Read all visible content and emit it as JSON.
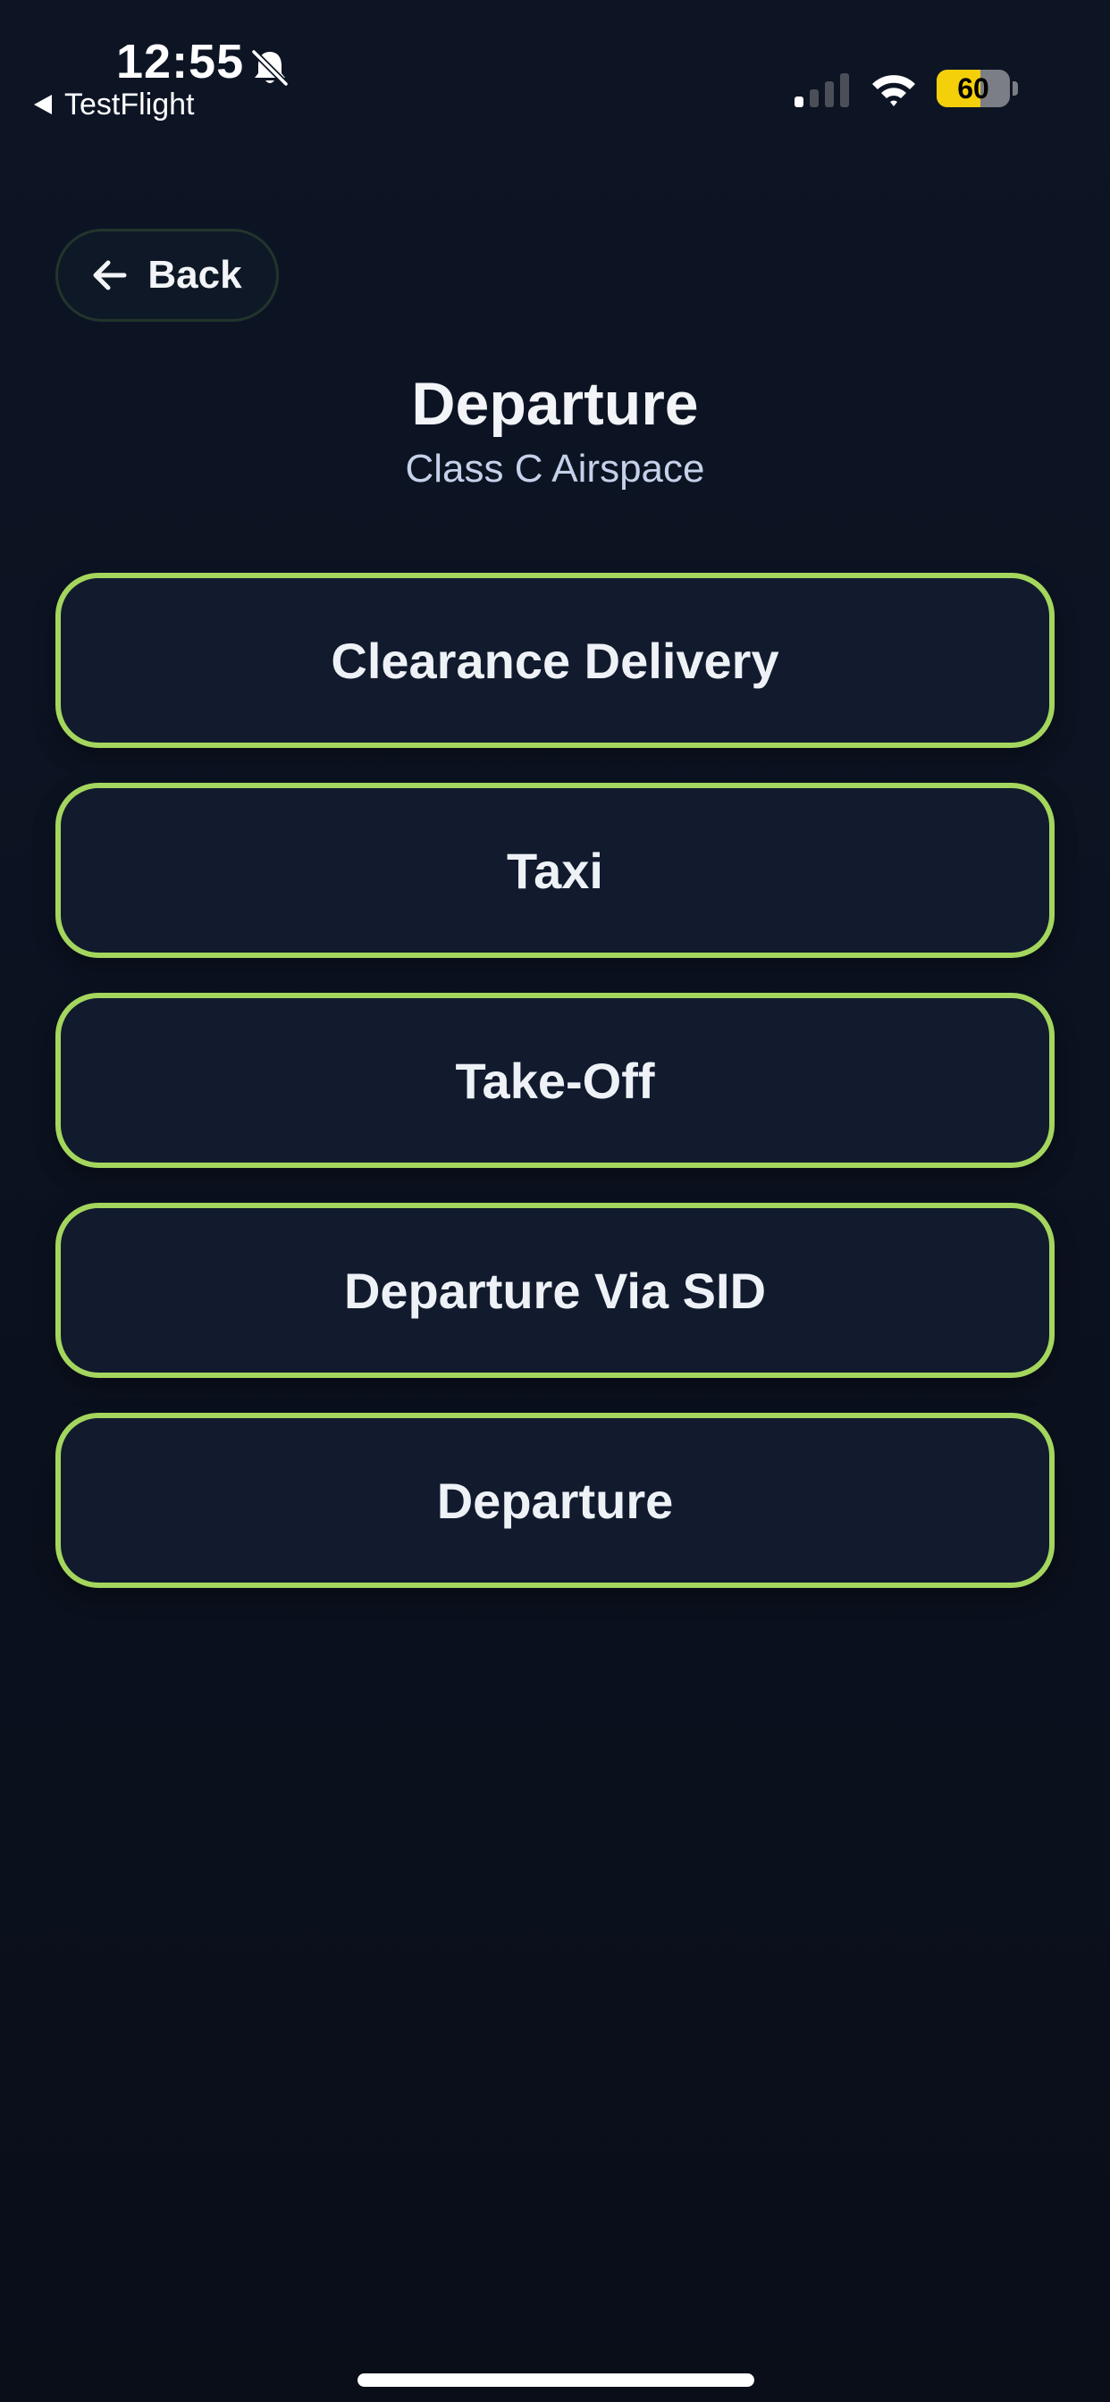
{
  "status_bar": {
    "time": "12:55",
    "back_app": "TestFlight",
    "battery": "60",
    "battery_level": 0.6,
    "icons": [
      "bell-slash-icon",
      "cellular-signal-icon",
      "wifi-icon",
      "battery-icon"
    ]
  },
  "nav": {
    "back_label": "Back",
    "back_icon": "arrow-left-icon"
  },
  "header": {
    "title": "Departure",
    "subtitle": "Class C Airspace"
  },
  "options": [
    {
      "label": "Clearance Delivery"
    },
    {
      "label": "Taxi"
    },
    {
      "label": "Take-Off"
    },
    {
      "label": "Departure Via SID"
    },
    {
      "label": "Departure"
    }
  ],
  "colors": {
    "background": "#0b1220",
    "button_background": "#111b2d",
    "accent_border": "#a4d65e",
    "subtitle": "#c5d1ea",
    "battery": "#f4d00b"
  }
}
